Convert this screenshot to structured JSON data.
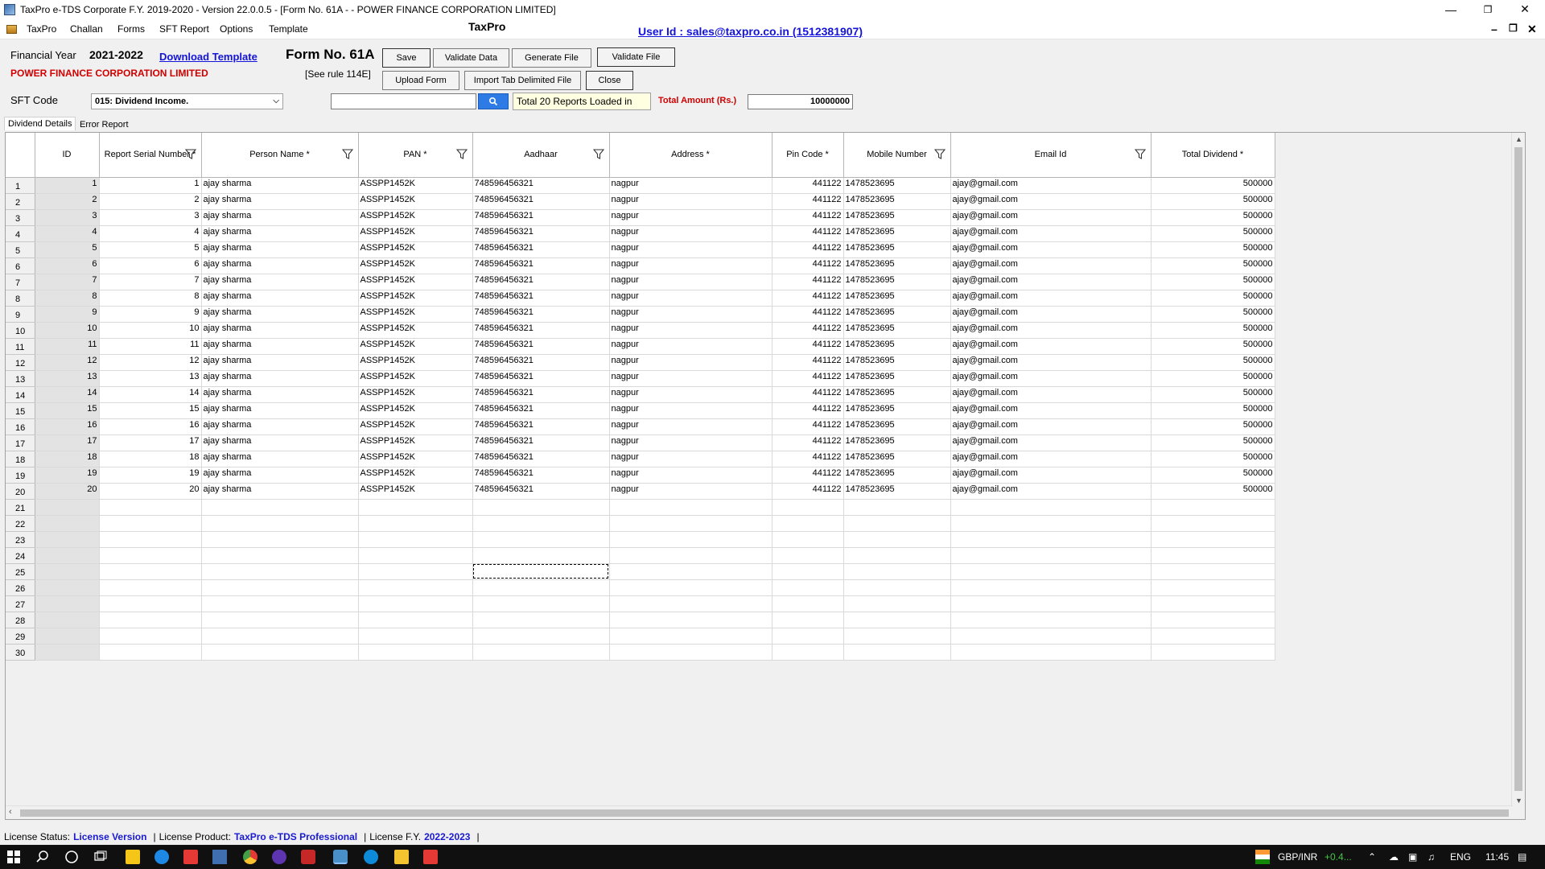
{
  "window": {
    "title": "TaxPro e-TDS Corporate F.Y. 2019-2020 - Version 22.0.0.5 - [Form No. 61A -  - POWER FINANCE CORPORATION LIMITED]",
    "minimize": "—",
    "restore": "❐",
    "close": "✕"
  },
  "menu": {
    "items": [
      "TaxPro",
      "Challan",
      "Forms",
      "SFT Report",
      "Options",
      "Template"
    ],
    "center_title": "TaxPro",
    "user_id": "User Id : sales@taxpro.co.in (1512381907)",
    "mdi_min": "–",
    "mdi_restore": "❐",
    "mdi_close": "✕"
  },
  "form": {
    "fy_label": "Financial Year",
    "fy_value": "2021-2022",
    "download_template": "Download Template",
    "company": "POWER FINANCE CORPORATION LIMITED",
    "form_no": "Form No. 61A",
    "rule": "[See rule 114E]",
    "sft_label": "SFT Code",
    "sft_value": "015: Dividend Income.",
    "buttons": {
      "save": "Save",
      "validate_data": "Validate Data",
      "generate_file": "Generate File",
      "validate_file": "Validate File",
      "upload_form": "Upload Form",
      "import_tab": "Import Tab Delimited File",
      "close": "Close"
    },
    "search_value": "",
    "loaded_msg": "Total 20 Reports Loaded in",
    "total_label": "Total Amount (Rs.)",
    "total_value": "10000000"
  },
  "tabs": [
    "Dividend Details",
    "Error Report"
  ],
  "grid": {
    "columns": [
      {
        "label": "ID",
        "filter": false
      },
      {
        "label": "Report Serial Number *",
        "filter": true
      },
      {
        "label": "Person Name *",
        "filter": true
      },
      {
        "label": "PAN *",
        "filter": true
      },
      {
        "label": "Aadhaar",
        "filter": true
      },
      {
        "label": "Address *",
        "filter": false
      },
      {
        "label": "Pin Code *",
        "filter": false
      },
      {
        "label": "Mobile Number",
        "filter": true
      },
      {
        "label": "Email Id",
        "filter": true
      },
      {
        "label": "Total Dividend *",
        "filter": false
      }
    ],
    "row_headers": [
      "1",
      "2",
      "3",
      "4",
      "5",
      "6",
      "7",
      "8",
      "9",
      "10",
      "11",
      "12",
      "13",
      "14",
      "15",
      "16",
      "17",
      "18",
      "19",
      "20",
      "21",
      "22",
      "23",
      "24",
      "25",
      "26",
      "27",
      "28",
      "29",
      "30"
    ],
    "rows": [
      [
        "1",
        "1",
        "ajay sharma",
        "ASSPP1452K",
        "748596456321",
        "nagpur",
        "441122",
        "1478523695",
        "ajay@gmail.com",
        "500000"
      ],
      [
        "2",
        "2",
        "ajay sharma",
        "ASSPP1452K",
        "748596456321",
        "nagpur",
        "441122",
        "1478523695",
        "ajay@gmail.com",
        "500000"
      ],
      [
        "3",
        "3",
        "ajay sharma",
        "ASSPP1452K",
        "748596456321",
        "nagpur",
        "441122",
        "1478523695",
        "ajay@gmail.com",
        "500000"
      ],
      [
        "4",
        "4",
        "ajay sharma",
        "ASSPP1452K",
        "748596456321",
        "nagpur",
        "441122",
        "1478523695",
        "ajay@gmail.com",
        "500000"
      ],
      [
        "5",
        "5",
        "ajay sharma",
        "ASSPP1452K",
        "748596456321",
        "nagpur",
        "441122",
        "1478523695",
        "ajay@gmail.com",
        "500000"
      ],
      [
        "6",
        "6",
        "ajay sharma",
        "ASSPP1452K",
        "748596456321",
        "nagpur",
        "441122",
        "1478523695",
        "ajay@gmail.com",
        "500000"
      ],
      [
        "7",
        "7",
        "ajay sharma",
        "ASSPP1452K",
        "748596456321",
        "nagpur",
        "441122",
        "1478523695",
        "ajay@gmail.com",
        "500000"
      ],
      [
        "8",
        "8",
        "ajay sharma",
        "ASSPP1452K",
        "748596456321",
        "nagpur",
        "441122",
        "1478523695",
        "ajay@gmail.com",
        "500000"
      ],
      [
        "9",
        "9",
        "ajay sharma",
        "ASSPP1452K",
        "748596456321",
        "nagpur",
        "441122",
        "1478523695",
        "ajay@gmail.com",
        "500000"
      ],
      [
        "10",
        "10",
        "ajay sharma",
        "ASSPP1452K",
        "748596456321",
        "nagpur",
        "441122",
        "1478523695",
        "ajay@gmail.com",
        "500000"
      ],
      [
        "11",
        "11",
        "ajay sharma",
        "ASSPP1452K",
        "748596456321",
        "nagpur",
        "441122",
        "1478523695",
        "ajay@gmail.com",
        "500000"
      ],
      [
        "12",
        "12",
        "ajay sharma",
        "ASSPP1452K",
        "748596456321",
        "nagpur",
        "441122",
        "1478523695",
        "ajay@gmail.com",
        "500000"
      ],
      [
        "13",
        "13",
        "ajay sharma",
        "ASSPP1452K",
        "748596456321",
        "nagpur",
        "441122",
        "1478523695",
        "ajay@gmail.com",
        "500000"
      ],
      [
        "14",
        "14",
        "ajay sharma",
        "ASSPP1452K",
        "748596456321",
        "nagpur",
        "441122",
        "1478523695",
        "ajay@gmail.com",
        "500000"
      ],
      [
        "15",
        "15",
        "ajay sharma",
        "ASSPP1452K",
        "748596456321",
        "nagpur",
        "441122",
        "1478523695",
        "ajay@gmail.com",
        "500000"
      ],
      [
        "16",
        "16",
        "ajay sharma",
        "ASSPP1452K",
        "748596456321",
        "nagpur",
        "441122",
        "1478523695",
        "ajay@gmail.com",
        "500000"
      ],
      [
        "17",
        "17",
        "ajay sharma",
        "ASSPP1452K",
        "748596456321",
        "nagpur",
        "441122",
        "1478523695",
        "ajay@gmail.com",
        "500000"
      ],
      [
        "18",
        "18",
        "ajay sharma",
        "ASSPP1452K",
        "748596456321",
        "nagpur",
        "441122",
        "1478523695",
        "ajay@gmail.com",
        "500000"
      ],
      [
        "19",
        "19",
        "ajay sharma",
        "ASSPP1452K",
        "748596456321",
        "nagpur",
        "441122",
        "1478523695",
        "ajay@gmail.com",
        "500000"
      ],
      [
        "20",
        "20",
        "ajay sharma",
        "ASSPP1452K",
        "748596456321",
        "nagpur",
        "441122",
        "1478523695",
        "ajay@gmail.com",
        "500000"
      ]
    ],
    "selected_row": 25,
    "selected_column": "Aadhaar"
  },
  "status": {
    "license_status_label": "License Status:",
    "license_status_value": "License Version",
    "license_product_label": "License Product:",
    "license_product_value": "TaxPro e-TDS Professional",
    "license_fy_label": "License F.Y.",
    "license_fy_value": "2022-2023",
    "sep": "|"
  },
  "taskbar": {
    "currency": "GBP/INR",
    "change": "+0.4...",
    "lang": "ENG",
    "time": "11:45"
  },
  "colors": {
    "accent_blue": "#1414d9",
    "company_red": "#d00000",
    "search_button": "#2f7be6",
    "loaded_bg": "#ffffe1"
  }
}
